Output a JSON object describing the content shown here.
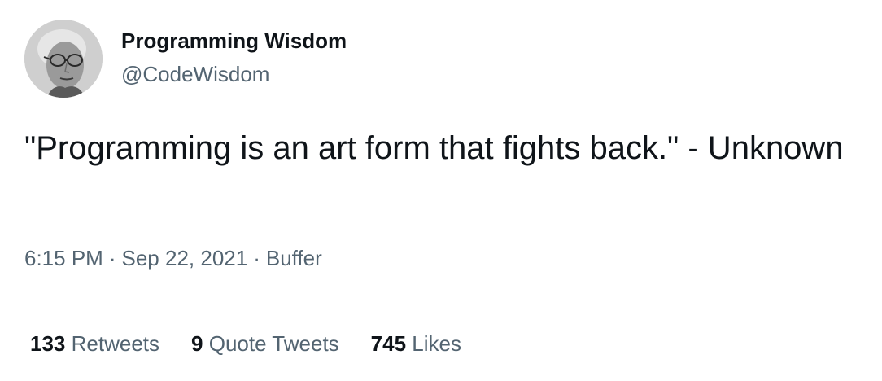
{
  "author": {
    "name": "Programming Wisdom",
    "handle": "@CodeWisdom",
    "avatar_icon": "grayscale-portrait-photo"
  },
  "tweet": {
    "text": "\"Programming is an art form that fights back.\" - Unknown",
    "time": "6:15 PM",
    "date": "Sep 22, 2021",
    "source": "Buffer",
    "separator": "·"
  },
  "stats": {
    "retweets_count": "133",
    "retweets_label": "Retweets",
    "quote_count": "9",
    "quote_label": "Quote Tweets",
    "likes_count": "745",
    "likes_label": "Likes"
  },
  "colors": {
    "primary_text": "#0f1419",
    "secondary_text": "#536471",
    "divider": "#eff3f4"
  }
}
